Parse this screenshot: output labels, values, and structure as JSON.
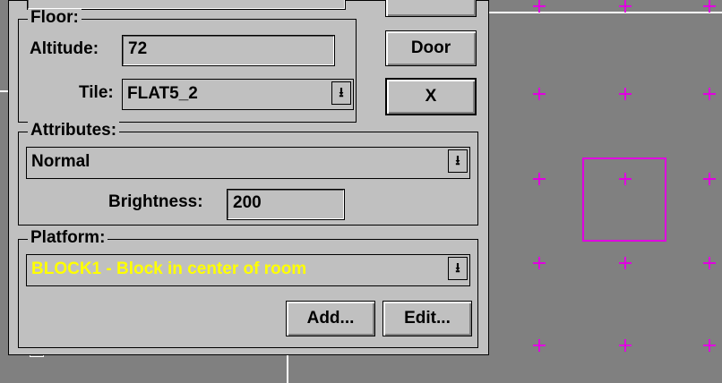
{
  "floor": {
    "title": "Floor:",
    "altitude_label": "Altitude:",
    "altitude_value": "72",
    "tile_label": "Tile:",
    "tile_value": "FLAT5_2"
  },
  "buttons": {
    "door": "Door",
    "close": "X",
    "add": "Add...",
    "edit": "Edit..."
  },
  "attributes": {
    "title": "Attributes:",
    "type_value": "Normal",
    "brightness_label": "Brightness:",
    "brightness_value": "200"
  },
  "platform": {
    "title": "Platform:",
    "selected": "BLOCK1 - Block in center of room",
    "selected_color": "#ffff00"
  },
  "icons": {
    "dropdown": "down-arrow-with-bar",
    "vertex_marker": "plus"
  },
  "colors": {
    "dialog_bg": "#c0c0c0",
    "map_bg": "#808080",
    "marker": "#e000e0"
  }
}
